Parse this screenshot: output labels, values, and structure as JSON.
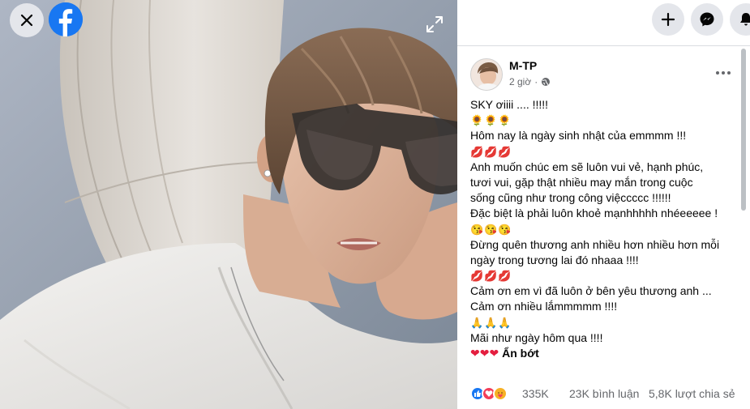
{
  "viewer": {
    "close_icon": "close-icon",
    "logo_icon": "facebook-logo-icon",
    "expand_icon": "expand-icon"
  },
  "topbar": {
    "create_icon": "plus-icon",
    "messenger_icon": "messenger-icon",
    "notifications_icon": "bell-icon"
  },
  "post": {
    "author": "M-TP",
    "time": "2 giờ",
    "privacy_icon": "globe-icon",
    "more_icon": "more-horizontal-icon",
    "lines": [
      "SKY ơiiii .... !!!!!",
      "🌻🌻🌻",
      "Hôm nay là ngày sinh nhật của emmmm !!!",
      "💋💋💋",
      "Anh muốn chúc em sẽ luôn vui vẻ, hạnh phúc,",
      "tươi vui, gặp thật nhiều may mắn trong cuộc",
      "sống cũng như trong công việccccc !!!!!!",
      "Đặc biệt là phải luôn khoẻ mạnhhhhh nhéeeeee !",
      "😘😘😘",
      "Đừng quên thương anh nhiều hơn nhiều hơn mỗi",
      "ngày trong tương lai đó nhaaa !!!!",
      "💋💋💋",
      "Cảm ơn em vì đã luôn ở bên yêu thương anh ...",
      "Cảm ơn nhiều lắmmmmm !!!!",
      "🙏🙏🙏",
      "Mãi như ngày hôm qua !!!!"
    ],
    "last_emojis": "❤❤❤",
    "see_less": "Ẩn bớt"
  },
  "stats": {
    "reactions_count": "335K",
    "comments": "23K bình luận",
    "shares": "5,8K lượt chia sẻ"
  },
  "colors": {
    "facebook_blue": "#1877f2",
    "like_blue": "#1877f2",
    "love_red": "#f33e58",
    "care_yellow": "#f7b125"
  }
}
